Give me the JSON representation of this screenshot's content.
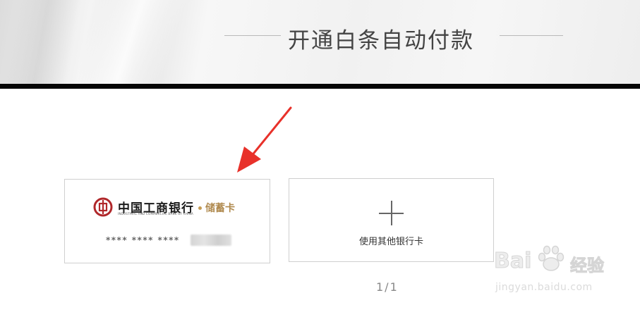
{
  "header": {
    "title": "开通白条自动付款"
  },
  "bank_card": {
    "bank_name": "中国工商银行",
    "bank_name_en": "INDUSTRIAL AND COMMERCIAL BANK OF CHINA",
    "card_type": "储蓄卡",
    "card_number_masked": "**** **** ****"
  },
  "add_card": {
    "label": "使用其他银行卡",
    "icon": "plus-icon"
  },
  "pagination": {
    "text": "1/1"
  },
  "watermark": {
    "brand": "Bai",
    "brand_suffix": "经验",
    "url": "jingyan.baidu.com"
  },
  "colors": {
    "annotation_arrow": "#e8312a",
    "bank_logo": "#b0282b",
    "card_type": "#b08a4f",
    "divider_bar": "#050505"
  }
}
